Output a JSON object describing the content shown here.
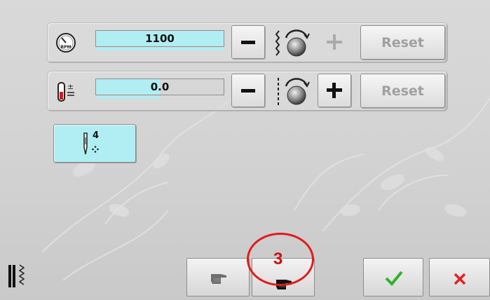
{
  "speed_row": {
    "icon": "speedometer-rpm-icon",
    "value": "1100",
    "fill_fraction": 1.0,
    "minus_label": "−",
    "plus_label": "+",
    "plus_enabled": false,
    "knob_icon": "stitch-knob-icon",
    "reset_label": "Reset",
    "reset_enabled": false
  },
  "tension_row": {
    "icon": "thread-tension-icon",
    "value": "0.0",
    "fill_fraction": 0.5,
    "minus_label": "−",
    "plus_label": "+",
    "plus_enabled": true,
    "knob_icon": "tension-knob-icon",
    "reset_label": "Reset",
    "reset_enabled": false
  },
  "needle_button": {
    "icon": "needle-icon",
    "number": "4"
  },
  "bottom_bar": {
    "status_icon": "stitch-status-icon",
    "hand_buttons": [
      "hand-pointer-icon",
      "hand-pointer-active-icon"
    ],
    "confirm_icon": "check-icon",
    "cancel_icon": "close-icon"
  },
  "annotation": {
    "number": "3"
  },
  "colors": {
    "accent_fill": "#b0eef3",
    "confirm_green": "#2fb22f",
    "cancel_red": "#e02020",
    "annotation_red": "#e41a1a",
    "disabled_text": "#a0a0a0"
  }
}
